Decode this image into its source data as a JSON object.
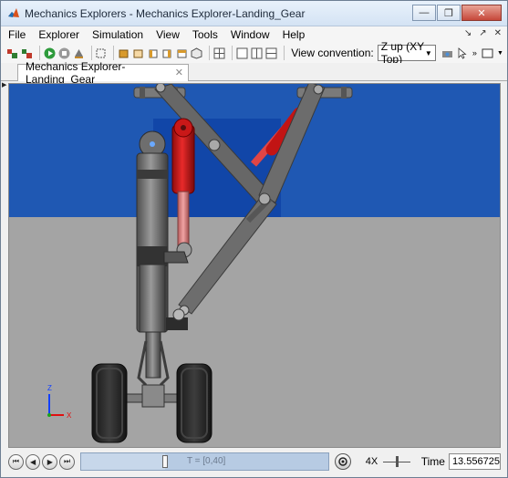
{
  "window": {
    "title": "Mechanics Explorers - Mechanics Explorer-Landing_Gear",
    "minimize": "—",
    "maximize": "❐",
    "close": "✕"
  },
  "menu": {
    "items": [
      "File",
      "Explorer",
      "Simulation",
      "View",
      "Tools",
      "Window",
      "Help"
    ],
    "right_controls": [
      "↘",
      "↗",
      "✕"
    ]
  },
  "toolbar": {
    "view_convention_label": "View convention:",
    "view_convention_value": "Z up (XY Top)"
  },
  "tab": {
    "label": "Mechanics Explorer-Landing_Gear",
    "close": "✕"
  },
  "triad": {
    "z": "Z",
    "x": "X"
  },
  "playback": {
    "time_range": "T = [0,40]",
    "speed": "4X",
    "time_label": "Time",
    "time_value": "13.556725",
    "progress_fraction": 0.339,
    "buttons": [
      "⏮",
      "◀",
      "▶",
      "⏭"
    ]
  },
  "colors": {
    "sky": "#1f58b3",
    "ground": "#a4a4a4",
    "strut_red": "#d41a1a",
    "metal": "#6f6f6f",
    "tire": "#262626"
  }
}
